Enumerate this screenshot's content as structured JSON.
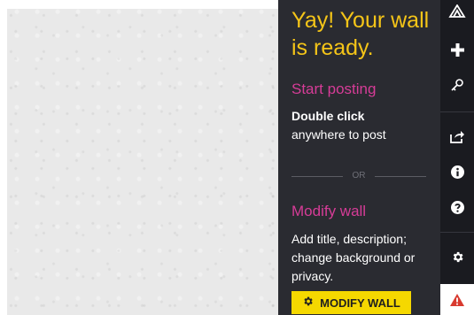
{
  "panel": {
    "title": "Yay! Your wall is ready.",
    "start_heading": "Start posting",
    "instruction_strong": "Double click",
    "instruction_rest": "anywhere to post",
    "divider_text": "OR",
    "modify_heading": "Modify wall",
    "modify_text": "Add title, description; change background or privacy.",
    "modify_button_label": "MODIFY WALL",
    "modify_button_icon": "gear-icon"
  },
  "toolbar": {
    "items": [
      {
        "name": "logo-icon"
      },
      {
        "name": "add-icon"
      },
      {
        "name": "key-icon"
      },
      {
        "name": "share-icon"
      },
      {
        "name": "info-icon"
      },
      {
        "name": "help-icon"
      },
      {
        "name": "settings-icon"
      },
      {
        "name": "alert-icon"
      }
    ]
  },
  "colors": {
    "title": "#f5c518",
    "heading": "#d63c97",
    "panel_bg": "#2a2b31",
    "toolbar_bg": "#1a1b20",
    "button_bg": "#f5d800",
    "alert": "#d83a2f"
  }
}
